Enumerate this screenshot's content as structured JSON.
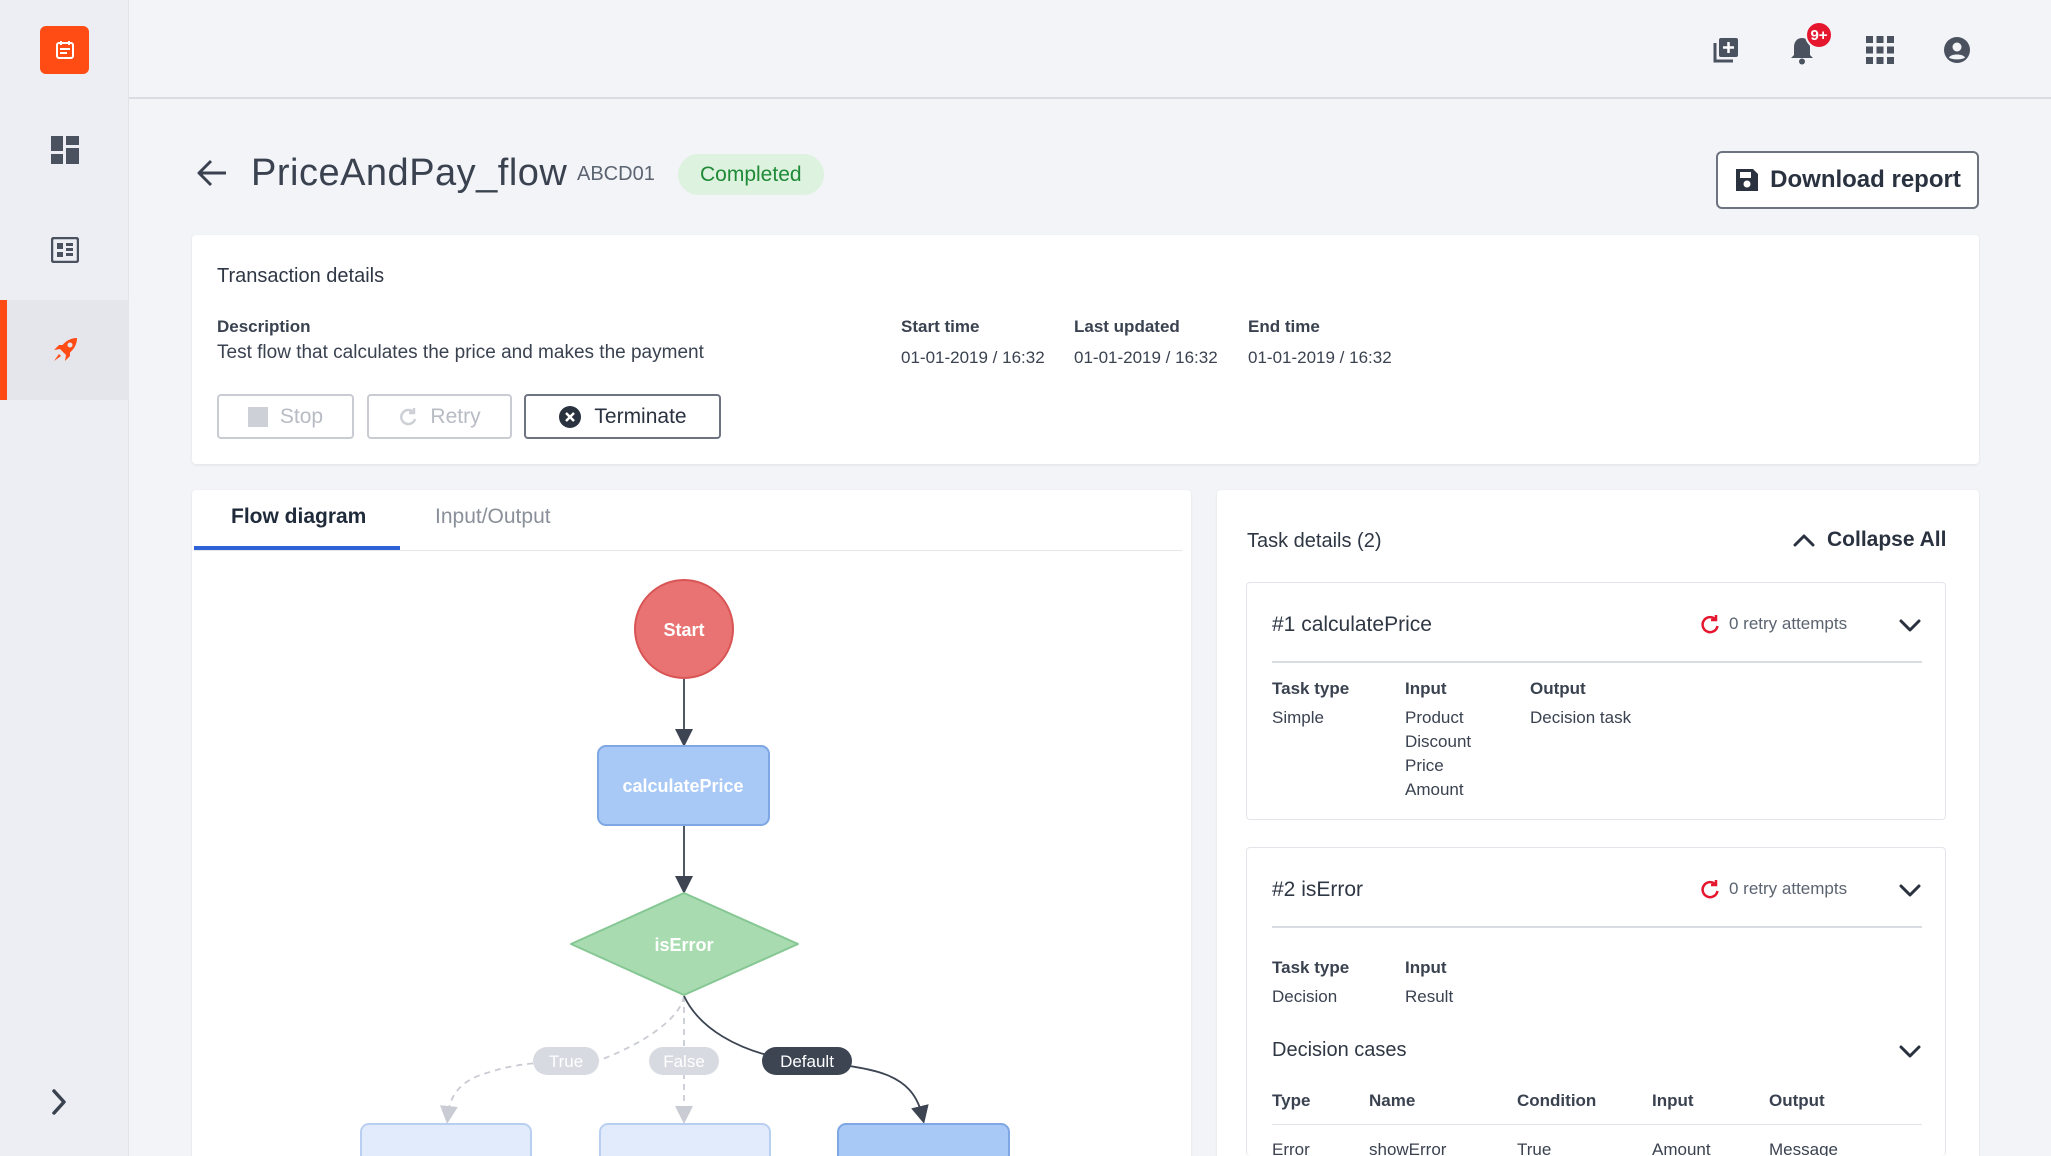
{
  "header": {
    "title": "PriceAndPay_flow",
    "code": "ABCD01",
    "status": "Completed",
    "download_label": "Download report",
    "notification_badge": "9+"
  },
  "transaction": {
    "title": "Transaction details",
    "description_label": "Description",
    "description": "Test flow that calculates the price and makes the payment",
    "start_label": "Start time",
    "start_value": "01-01-2019 / 16:32",
    "updated_label": "Last updated",
    "updated_value": "01-01-2019 / 16:32",
    "end_label": "End time",
    "end_value": "01-01-2019 / 16:32",
    "buttons": {
      "stop": "Stop",
      "retry": "Retry",
      "terminate": "Terminate"
    }
  },
  "tabs": {
    "flow": "Flow diagram",
    "io": "Input/Output"
  },
  "flow": {
    "start": "Start",
    "calculate": "calculatePrice",
    "decision": "isError",
    "edge_true": "True",
    "edge_false": "False",
    "edge_default": "Default"
  },
  "tasks": {
    "title": "Task details (2)",
    "collapse_label": "Collapse All",
    "task1": {
      "title": "#1 calculatePrice",
      "retry": "0 retry attempts",
      "type_label": "Task type",
      "type_value": "Simple",
      "input_label": "Input",
      "inputs": [
        "Product",
        "Discount",
        "Price",
        "Amount"
      ],
      "output_label": "Output",
      "output_value": "Decision task"
    },
    "task2": {
      "title": "#2 isError",
      "retry": "0 retry attempts",
      "type_label": "Task type",
      "type_value": "Decision",
      "input_label": "Input",
      "input_value": "Result",
      "cases_title": "Decision cases",
      "columns": [
        "Type",
        "Name",
        "Condition",
        "Input",
        "Output"
      ],
      "row": [
        "Error",
        "showError",
        "True",
        "Amount",
        "Message"
      ]
    }
  },
  "icons": {
    "logo": "calendar-icon",
    "nav": [
      "dashboard-icon",
      "table-icon",
      "rocket-icon"
    ],
    "expand": "chevron-right-icon",
    "top": [
      "add-box-icon",
      "bell-icon",
      "apps-grid-icon",
      "account-icon"
    ]
  },
  "colors": {
    "accent": "#ff4b14",
    "status_bg": "#ddf2df",
    "status_text": "#1f8a37",
    "start_node": "#e97373",
    "task_node": "#a8c8f5",
    "decision_node": "#a8dcb0",
    "tab_active": "#2f62d6"
  }
}
